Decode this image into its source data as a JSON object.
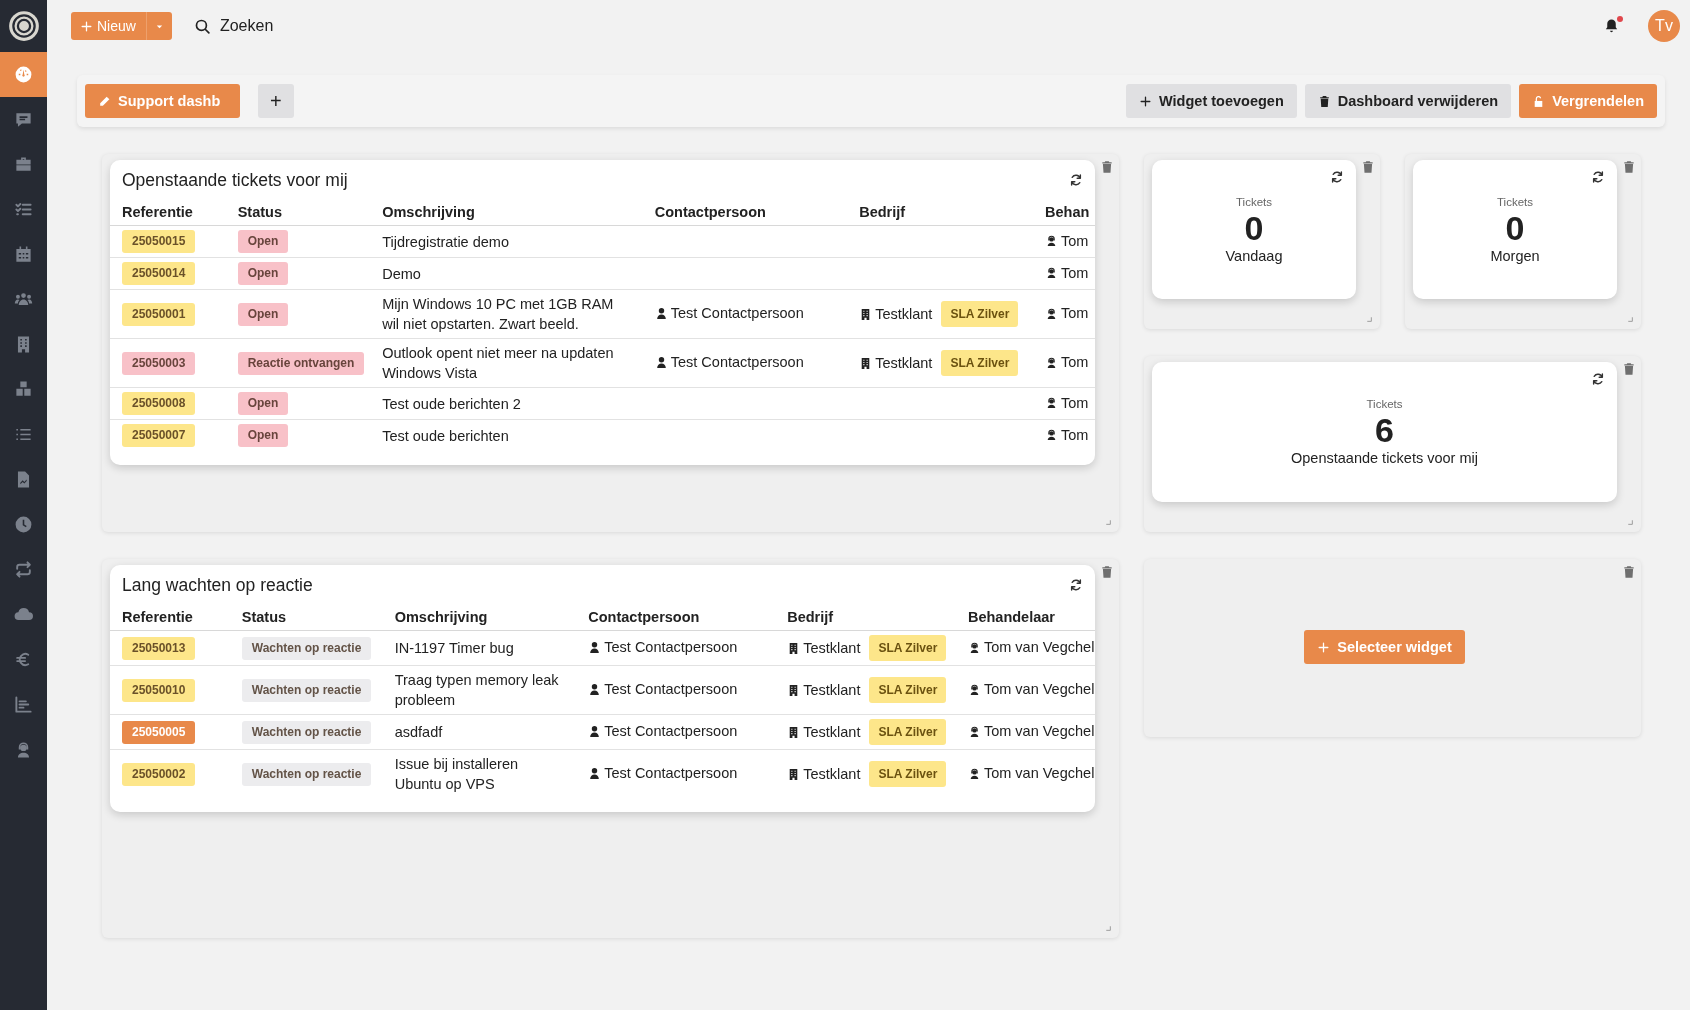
{
  "sidebar": {
    "items": [
      {
        "selected": true
      },
      {
        "selected": false
      },
      {
        "selected": false
      },
      {
        "selected": false
      },
      {
        "selected": false
      },
      {
        "selected": false
      },
      {
        "selected": false
      },
      {
        "selected": false
      },
      {
        "selected": false
      },
      {
        "selected": false
      },
      {
        "selected": false
      },
      {
        "selected": false
      },
      {
        "selected": false
      },
      {
        "selected": false
      },
      {
        "selected": false
      },
      {
        "selected": false
      }
    ]
  },
  "topbar": {
    "new_button": "Nieuw",
    "search": {
      "placeholder": "Zoeken"
    },
    "has_notification": true,
    "avatar": "Tv"
  },
  "dashboard_tabs": [
    {
      "label": "Support dashb",
      "selected": true
    }
  ],
  "add_tab_button": "+",
  "actions": [
    {
      "label": "Widget toevoegen",
      "kind": "add"
    },
    {
      "label": "Dashboard verwijderen",
      "kind": "delete"
    },
    {
      "label": "Vergrendelen",
      "kind": "lock"
    }
  ],
  "widgets": [
    {
      "kind": "table",
      "title": "Openstaande tickets voor mij",
      "columns": [
        "Referentie",
        "Status",
        "Omschrijving",
        "Contactpersoon",
        "Bedrijf",
        "Behan"
      ],
      "rows": [
        {
          "reference": {
            "text": "25050015",
            "color": "#fde68a"
          },
          "status": {
            "text": "Open",
            "color": "#f8c1c8"
          },
          "description": "Tijdregistratie demo",
          "handler": "Tom"
        },
        {
          "reference": {
            "text": "25050014",
            "color": "#fde68a"
          },
          "status": {
            "text": "Open",
            "color": "#f8c1c8"
          },
          "description": "Demo",
          "handler": "Tom"
        },
        {
          "reference": {
            "text": "25050001",
            "color": "#fde68a"
          },
          "status": {
            "text": "Open",
            "color": "#f8c1c8"
          },
          "description": "Mijn Windows 10 PC met 1GB RAM wil niet opstarten. Zwart beeld.",
          "contact": "Test Contactpersoon",
          "company": {
            "name": "Testklant",
            "sla": "SLA Zilver"
          },
          "handler": "Tom"
        },
        {
          "reference": {
            "text": "25050003",
            "color": "#f8c1c8"
          },
          "status": {
            "text": "Reactie ontvangen",
            "color": "#f8c1c8"
          },
          "description": "Outlook opent niet meer na updaten Windows Vista",
          "contact": "Test Contactpersoon",
          "company": {
            "name": "Testklant",
            "sla": "SLA Zilver"
          },
          "handler": "Tom"
        },
        {
          "reference": {
            "text": "25050008",
            "color": "#fde68a"
          },
          "status": {
            "text": "Open",
            "color": "#f8c1c8"
          },
          "description": "Test oude berichten 2",
          "handler": "Tom"
        },
        {
          "reference": {
            "text": "25050007",
            "color": "#fde68a"
          },
          "status": {
            "text": "Open",
            "color": "#f8c1c8"
          },
          "description": "Test oude berichten",
          "handler": "Tom"
        }
      ]
    },
    {
      "kind": "stat",
      "label": "Tickets",
      "value": "0",
      "caption": "Vandaag"
    },
    {
      "kind": "stat",
      "label": "Tickets",
      "value": "0",
      "caption": "Morgen"
    },
    {
      "kind": "stat",
      "label": "Tickets",
      "value": "6",
      "caption": "Openstaande tickets voor mij"
    },
    {
      "kind": "table",
      "title": "Lang wachten op reactie",
      "columns": [
        "Referentie",
        "Status",
        "Omschrijving",
        "Contactpersoon",
        "Bedrijf",
        "Behandelaar"
      ],
      "rows": [
        {
          "reference": {
            "text": "25050013",
            "color": "#fde68a"
          },
          "status": {
            "text": "Wachten op reactie",
            "color": "#ececee"
          },
          "description": "IN-1197 Timer bug",
          "contact": "Test Contactpersoon",
          "company": {
            "name": "Testklant",
            "sla": "SLA Zilver"
          },
          "handler": "Tom van Vegchel"
        },
        {
          "reference": {
            "text": "25050010",
            "color": "#fde68a"
          },
          "status": {
            "text": "Wachten op reactie",
            "color": "#ececee"
          },
          "description": "Traag typen memory leak probleem",
          "contact": "Test Contactpersoon",
          "company": {
            "name": "Testklant",
            "sla": "SLA Zilver"
          },
          "handler": "Tom van Vegchel"
        },
        {
          "reference": {
            "text": "25050005",
            "color": "#e8894a"
          },
          "status": {
            "text": "Wachten op reactie",
            "color": "#ececee"
          },
          "description": "asdfadf",
          "contact": "Test Contactpersoon",
          "company": {
            "name": "Testklant",
            "sla": "SLA Zilver"
          },
          "handler": "Tom van Vegchel"
        },
        {
          "reference": {
            "text": "25050002",
            "color": "#fde68a"
          },
          "status": {
            "text": "Wachten op reactie",
            "color": "#ececee"
          },
          "description": "Issue bij installeren Ubuntu op VPS",
          "contact": "Test Contactpersoon",
          "company": {
            "name": "Testklant",
            "sla": "SLA Zilver"
          },
          "handler": "Tom van Vegchel"
        }
      ]
    },
    {
      "kind": "empty",
      "button": "Selecteer widget"
    }
  ]
}
